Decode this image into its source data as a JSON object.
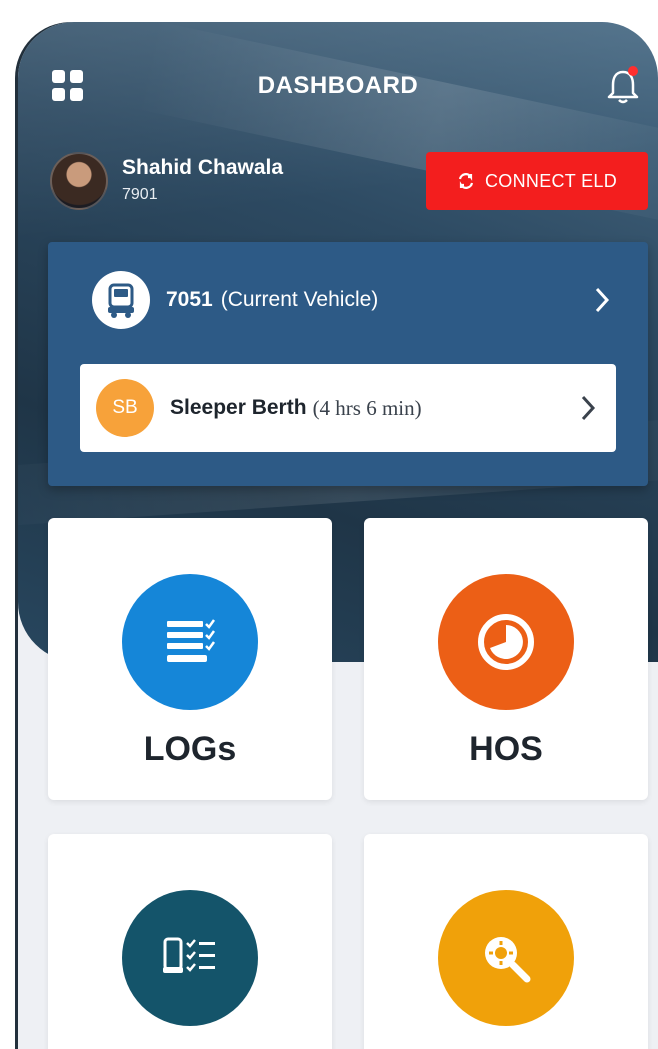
{
  "header": {
    "title": "DASHBOARD",
    "menu_icon": "grid-icon",
    "notification_icon": "bell-icon"
  },
  "user": {
    "name": "Shahid Chawala",
    "id": "7901"
  },
  "connect_button": {
    "label": "CONNECT ELD",
    "icon": "refresh-icon",
    "color": "#f31e1e"
  },
  "vehicle": {
    "number": "7051",
    "label": "(Current Vehicle)",
    "icon": "truck-icon"
  },
  "status": {
    "badge": "SB",
    "name": "Sleeper Berth",
    "duration": "(4 hrs 6 min)",
    "badge_color": "#f7a23a"
  },
  "tiles": [
    {
      "label": "LOGs",
      "icon": "logs-list-icon",
      "color": "#1586d8"
    },
    {
      "label": "HOS",
      "icon": "clock-icon",
      "color": "#ec5f16"
    },
    {
      "label": "",
      "icon": "truck-checklist-icon",
      "color": "#14546a"
    },
    {
      "label": "",
      "icon": "search-gear-icon",
      "color": "#f0a10a"
    }
  ]
}
